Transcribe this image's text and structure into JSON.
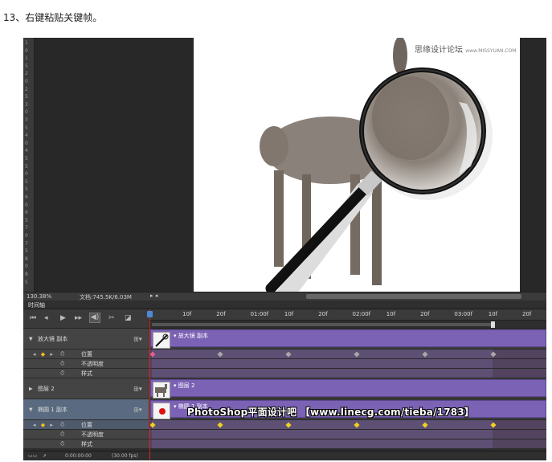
{
  "caption": "13、右键粘贴关键帧。",
  "watermark": {
    "main": "思缘设计论坛",
    "site": "www.MISSYUAN.COM"
  },
  "ruler_labels": [
    "1",
    "0",
    "1",
    "5",
    "2",
    "0",
    "2",
    "5",
    "3",
    "0",
    "3",
    "5",
    "4",
    "0",
    "4",
    "5",
    "5",
    "0",
    "5",
    "5",
    "6",
    "0",
    "6",
    "5",
    "7",
    "0",
    "7",
    "5",
    "8",
    "0",
    "8",
    "5"
  ],
  "statusbar": {
    "zoom": "130.38%",
    "doc": "文档:745.5K/6.03M"
  },
  "timeline": {
    "title": "时间轴",
    "ruler_ticks": [
      "10f",
      "20f",
      "01:00f",
      "10f",
      "20f",
      "02:00f",
      "10f",
      "20f",
      "03:00f",
      "10f",
      "20f"
    ],
    "layers": [
      {
        "name": "放大镜 副本",
        "clip": "放大镜 副本",
        "expanded": true,
        "selected": false
      },
      {
        "name": "图层 2",
        "clip": "图层 2",
        "expanded": false,
        "selected": false
      },
      {
        "name": "椭圆 1 副本",
        "clip": "椭圆 1 副本",
        "expanded": true,
        "selected": true
      }
    ],
    "properties": [
      "位置",
      "不透明度",
      "样式"
    ],
    "footer": {
      "time": "0:00:00:00",
      "fps": "(30.00 fps)"
    }
  },
  "banner": "PhotoShop平面设计吧  【www.linecg.com/tieba/1783】",
  "colors": {
    "clip": "#7b62b5",
    "keyframe_yellow": "#f0d020",
    "keyframe_gray": "#a8a8a8",
    "playhead": "#d92020"
  }
}
